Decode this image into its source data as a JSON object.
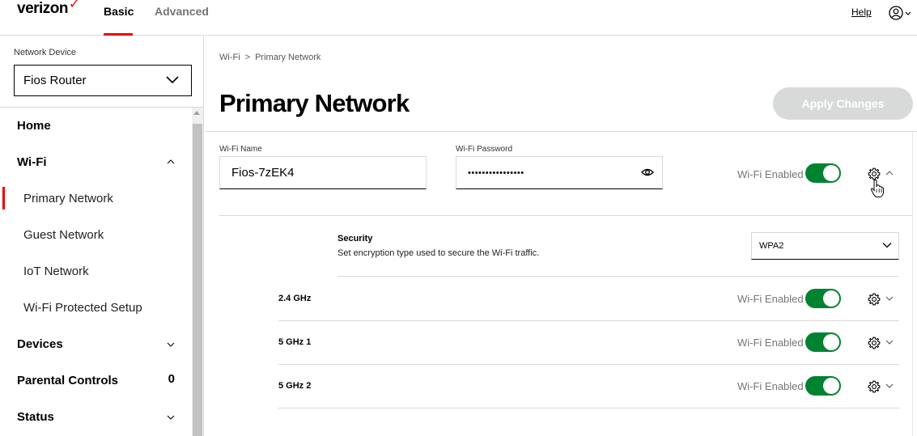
{
  "header": {
    "logo": "verizon",
    "logo_check": "✓",
    "tabs": [
      {
        "label": "Basic",
        "active": true
      },
      {
        "label": "Advanced",
        "active": false
      }
    ],
    "help_link": "Help"
  },
  "sidebar": {
    "device_label": "Network Device",
    "device_value": "Fios Router",
    "items": [
      {
        "label": "Home",
        "level": "top"
      },
      {
        "label": "Wi-Fi",
        "level": "top",
        "expanded": true
      },
      {
        "label": "Primary Network",
        "level": "sub",
        "active": true
      },
      {
        "label": "Guest Network",
        "level": "sub"
      },
      {
        "label": "IoT Network",
        "level": "sub"
      },
      {
        "label": "Wi-Fi Protected Setup",
        "level": "sub"
      },
      {
        "label": "Devices",
        "level": "top"
      },
      {
        "label": "Parental Controls",
        "level": "top",
        "count": "0"
      },
      {
        "label": "Status",
        "level": "top"
      }
    ]
  },
  "main": {
    "breadcrumb": {
      "parent": "Wi-Fi",
      "separator": ">",
      "current": "Primary Network"
    },
    "title": "Primary Network",
    "apply_button": "Apply Changes",
    "wifi_name_label": "Wi-Fi Name",
    "wifi_name_value": "Fios-7zEK4",
    "wifi_password_label": "Wi-Fi Password",
    "wifi_password_value": "••••••••••••••••",
    "wifi_enabled_label": "Wi-Fi Enabled",
    "security": {
      "title": "Security",
      "description": "Set encryption type used to secure the Wi-Fi traffic.",
      "selected": "WPA2"
    },
    "bands": [
      {
        "label": "2.4 GHz",
        "toggle_label": "Wi-Fi Enabled",
        "enabled": true
      },
      {
        "label": "5 GHz 1",
        "toggle_label": "Wi-Fi Enabled",
        "enabled": true
      },
      {
        "label": "5 GHz 2",
        "toggle_label": "Wi-Fi Enabled",
        "enabled": true
      }
    ]
  },
  "colors": {
    "brand_red": "#ee0000",
    "toggle_green": "#008331",
    "disabled_button": "#d8dada",
    "muted_text": "#747676"
  },
  "icons": [
    "chevron-down-icon",
    "chevron-up-icon",
    "eye-icon",
    "gear-icon",
    "user-icon",
    "hand-cursor-icon"
  ]
}
